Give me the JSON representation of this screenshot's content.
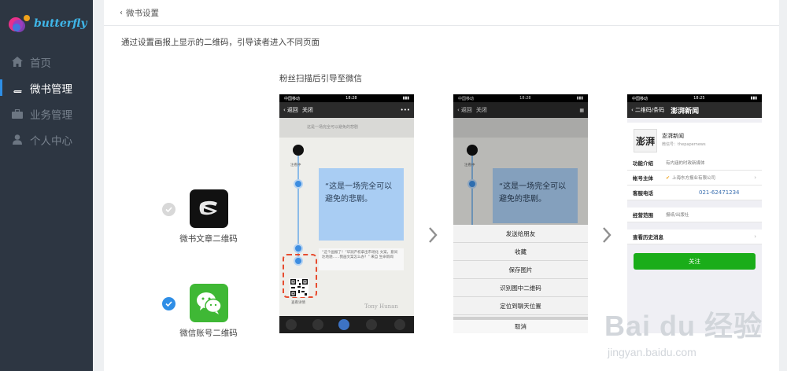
{
  "app": {
    "logo_text": "butterfly"
  },
  "sidebar": {
    "items": [
      {
        "label": "首页",
        "icon": "home-icon"
      },
      {
        "label": "微书管理",
        "icon": "book-icon",
        "active": true
      },
      {
        "label": "业务管理",
        "icon": "briefcase-icon"
      },
      {
        "label": "个人中心",
        "icon": "user-icon"
      }
    ]
  },
  "breadcrumb": {
    "label": "微书设置"
  },
  "description": "通过设置画报上显示的二维码，引导读者进入不同页面",
  "flow_title": "粉丝扫描后引导至微信",
  "options": [
    {
      "label": "微书文章二维码",
      "selected": false
    },
    {
      "label": "微信账号二维码",
      "selected": true
    }
  ],
  "phone1": {
    "carrier": "中国移动",
    "time": "18:28",
    "back": "返回",
    "close": "关闭",
    "more": "•••",
    "header_text": "这是一场完全可以避免的悲剧",
    "follow_text": "注看中",
    "quote": "“这是一场完全可以避免的悲剧。",
    "comment": "“这个画报了！”华润产权拿出市场化 文案，意间达地驰……我画文案怎么办？” 来自 生命新闻",
    "qr_caption": "查看详情",
    "watermark": "Tony Hunan"
  },
  "phone2": {
    "carrier": "中国移动",
    "time": "18:28",
    "back": "返回",
    "close": "关闭",
    "quote": "“这是一场完全可以避免的悲剧。",
    "follow_text": "注看中",
    "menu": [
      "发送给朋友",
      "收藏",
      "保存图片",
      "识别图中二维码",
      "定位到聊天位置"
    ],
    "cancel": "取消"
  },
  "phone3": {
    "carrier": "中国移动",
    "time": "18:25",
    "back": "二维码/条码",
    "title": "澎湃新闻",
    "logo_text": "澎湃",
    "account_name": "澎湃新闻",
    "wechat_id": "微信号：thepapernews",
    "rows": [
      {
        "key": "功能介绍",
        "value": "有内涵的时政新媒体"
      },
      {
        "key": "帐号主体",
        "value": "上海东方报业有限公司"
      },
      {
        "key": "客服电话",
        "value": "021-62471234"
      },
      {
        "key": "经营范围",
        "value": "报纸/出版社"
      },
      {
        "key": "查看历史消息",
        "value": ""
      }
    ],
    "follow": "关注"
  },
  "watermark": {
    "main": "Bai du 经验",
    "sub": "jingyan.baidu.com"
  },
  "colors": {
    "sidebar_bg": "#2d3642",
    "accent": "#2f8ee6",
    "wechat_green": "#1aad19",
    "dash_red": "#e74c2f"
  }
}
